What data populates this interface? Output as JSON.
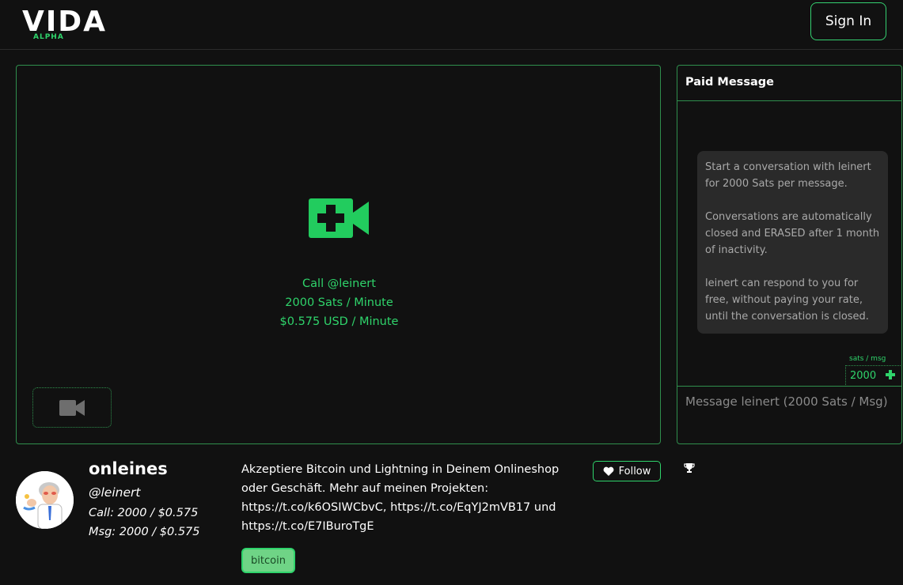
{
  "header": {
    "logo_text": "VIDA",
    "logo_sub": "ALPHA",
    "signin_label": "Sign In"
  },
  "call": {
    "line1": "Call @leinert",
    "line2": "2000 Sats / Minute",
    "line3": "$0.575 USD / Minute",
    "icon": "video-plus-icon",
    "toggle_icon": "video-camera-icon"
  },
  "paid_message": {
    "title": "Paid Message",
    "info_p1": "Start a conversation with leinert for 2000 Sats per message.",
    "info_p2": "Conversations are automatically closed and ERASED after 1 month of inactivity.",
    "info_p3": "leinert can respond to you for free, without paying your rate, until the conversation is closed.",
    "rate_label": "sats / msg",
    "rate_value": "2000",
    "input_placeholder": "Message leinert (2000 Sats / Msg)"
  },
  "profile": {
    "display_name": "onleines",
    "handle": "@leinert",
    "call_rate": "Call: 2000 / $0.575",
    "msg_rate": "Msg: 2000 / $0.575",
    "bio": "Akzeptiere Bitcoin und Lightning in Deinem Onlineshop oder Geschäft. Mehr auf meinen Projekten: https://t.co/k6OSIWCbvC, https://t.co/EqYJ2mVB17 und https://t.co/E7IBuroTgE",
    "tag": "bitcoin",
    "follow_label": "Follow"
  },
  "colors": {
    "accent": "#2fd46b",
    "border": "#2f8f4d",
    "background": "#111111",
    "info_box": "#2a2a2a"
  }
}
